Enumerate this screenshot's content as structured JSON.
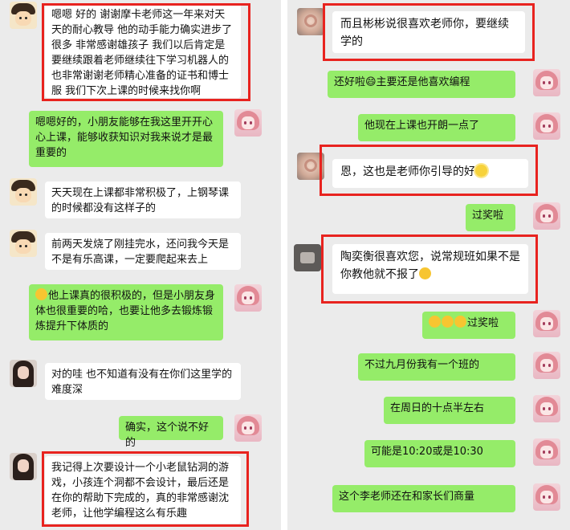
{
  "left_chat": {
    "messages": [
      {
        "side": "left",
        "avatar": "child-avatar",
        "text": "嗯嗯 好的 谢谢摩卡老师这一年来对天天的耐心教导 他的动手能力确实进步了很多 非常感谢雄孩子 我们以后肯定是要继续跟着老师继续往下学习机器人的 也非常谢谢老师精心准备的证书和博士服 我们下次上课的时候来找你啊",
        "highlighted": true
      },
      {
        "side": "right",
        "avatar": "anime-avatar",
        "text": "嗯嗯好的，小朋友能够在我这里开开心心上课，能够收获知识对我来说才是最重要的"
      },
      {
        "side": "left",
        "avatar": "child-avatar",
        "text": "天天现在上课都非常积极了，上钢琴课的时候都没有这样子的"
      },
      {
        "side": "left",
        "avatar": "child-avatar",
        "text": "前两天发烧了刚挂完水，还问我今天是不是有乐高课，一定要爬起来去上"
      },
      {
        "side": "right",
        "avatar": "anime-avatar",
        "emoji": "grin-emoji",
        "text": "他上课真的很积极的，但是小朋友身体也很重要的哈，也要让他多去锻炼锻炼提升下体质的"
      },
      {
        "side": "left",
        "avatar": "girl-avatar",
        "text": "对的哇 也不知道有没有在你们这里学的难度深"
      },
      {
        "side": "right",
        "avatar": "anime-avatar",
        "text": "确实，这个说不好的"
      },
      {
        "side": "left",
        "avatar": "girl-avatar",
        "text": "我记得上次要设计一个小老鼠钻洞的游戏，小孩连个洞都不会设计，最后还是在你的帮助下完成的，真的非常感谢沈老师，让他学编程这么有乐趣",
        "highlighted": true
      }
    ]
  },
  "right_chat": {
    "messages": [
      {
        "side": "left",
        "avatar": "rose-avatar",
        "text": "而且彬彬说很喜欢老师你，要继续学的",
        "highlighted": true
      },
      {
        "side": "right",
        "avatar": "anime-avatar",
        "emoji": "grin-emoji",
        "text": "还好啦😄主要还是他喜欢编程"
      },
      {
        "side": "right",
        "avatar": "anime-avatar",
        "text": "他现在上课也开朗一点了"
      },
      {
        "side": "left",
        "avatar": "rose-avatar",
        "text": "恩，这也是老师你引导的好",
        "trailing_emoji": "sun-emoji",
        "highlighted": true
      },
      {
        "side": "right",
        "avatar": "anime-avatar",
        "text": "过奖啦"
      },
      {
        "side": "left",
        "avatar": "dark-avatar",
        "text": "陶奕衡很喜欢您，说常规班如果不是你教他就不报了",
        "trailing_emoji": "thinking-emoji",
        "highlighted": true
      },
      {
        "side": "right",
        "avatar": "anime-avatar",
        "emoji": "grin-emoji",
        "text": "过奖啦"
      },
      {
        "side": "right",
        "avatar": "anime-avatar",
        "text": "不过九月份我有一个班的"
      },
      {
        "side": "right",
        "avatar": "anime-avatar",
        "text": "在周日的十点半左右"
      },
      {
        "side": "right",
        "avatar": "anime-avatar",
        "text": "可能是10:20或是10:30"
      },
      {
        "side": "right",
        "avatar": "anime-avatar",
        "text": "这个李老师还在和家长们商量"
      }
    ]
  },
  "colors": {
    "highlight_box": "#e8231f",
    "bubble_green": "#95ec69",
    "bubble_white": "#ffffff",
    "chat_bg": "#ebebeb"
  }
}
